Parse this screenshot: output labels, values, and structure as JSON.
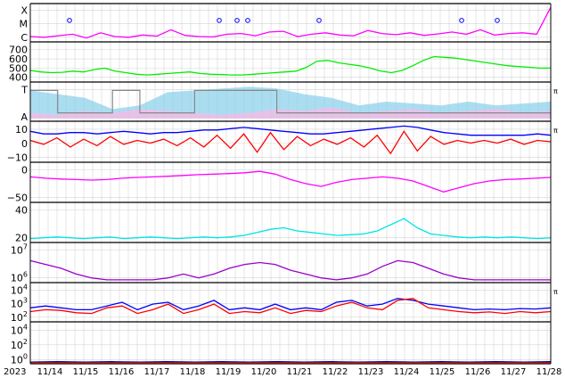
{
  "chart_data": {
    "type": "line",
    "x_axis": {
      "start_label": "2023",
      "tick_labels": [
        "11/14",
        "11/15",
        "11/16",
        "11/17",
        "11/18",
        "11/19",
        "11/20",
        "11/21",
        "11/22",
        "11/23",
        "11/24",
        "11/25",
        "11/26",
        "11/27",
        "11/28"
      ],
      "grid": true
    },
    "colors": {
      "magenta": "#ff00ff",
      "green": "#00ee00",
      "skyblue": "#87ceeb",
      "pink": "#ffb6e6",
      "gray": "#888888",
      "blue": "#0000ff",
      "red": "#ff0000",
      "purple": "#9900cc",
      "cyan": "#00e5e5",
      "darkblue": "#0000aa",
      "darkred": "#cc0000"
    },
    "panels": [
      {
        "id": "flare-class",
        "y_ticks": [
          "X",
          "M",
          "C"
        ],
        "right_label": "",
        "series": [
          {
            "color": "magenta",
            "kind": "line",
            "values": [
              0.12,
              0.1,
              0.14,
              0.18,
              0.08,
              0.22,
              0.12,
              0.1,
              0.16,
              0.13,
              0.3,
              0.15,
              0.12,
              0.11,
              0.18,
              0.2,
              0.14,
              0.24,
              0.26,
              0.12,
              0.18,
              0.22,
              0.16,
              0.14,
              0.28,
              0.2,
              0.17,
              0.22,
              0.15,
              0.19,
              0.24,
              0.18,
              0.3,
              0.16,
              0.2,
              0.22,
              0.18,
              0.9
            ]
          },
          {
            "color": "blue",
            "kind": "markers",
            "x_days": [
              1.1,
              5.3,
              5.8,
              6.1,
              8.1,
              12.1,
              13.1,
              18.9
            ],
            "values": [
              0.55,
              0.55,
              0.55,
              0.55,
              0.55,
              0.55,
              0.55,
              0.92
            ]
          }
        ]
      },
      {
        "id": "solar-wind-speed",
        "y_ticks": [
          "700",
          "600",
          "500",
          "400"
        ],
        "ylim": [
          300,
          800
        ],
        "right_label": "",
        "series": [
          {
            "color": "green",
            "kind": "line",
            "values": [
              440,
              420,
              410,
              415,
              430,
              420,
              450,
              470,
              430,
              410,
              390,
              380,
              390,
              400,
              410,
              420,
              400,
              390,
              385,
              380,
              380,
              390,
              400,
              410,
              420,
              430,
              480,
              560,
              570,
              540,
              520,
              500,
              470,
              430,
              410,
              440,
              500,
              570,
              620,
              610,
              600,
              580,
              560,
              540,
              520,
              500,
              490,
              480,
              470,
              470
            ]
          }
        ]
      },
      {
        "id": "imf-polarity",
        "y_ticks": [
          "T",
          "A"
        ],
        "right_label": "π",
        "series": [
          {
            "color": "skyblue",
            "kind": "band",
            "values": [
              0.8,
              0.7,
              0.6,
              0.3,
              0.4,
              0.75,
              0.8,
              0.85,
              0.9,
              0.85,
              0.7,
              0.6,
              0.4,
              0.5,
              0.45,
              0.4,
              0.5,
              0.4,
              0.45,
              0.5
            ]
          },
          {
            "color": "pink",
            "kind": "band",
            "values": [
              0.2,
              0.15,
              0.25,
              0.2,
              0.3,
              0.25,
              0.2,
              0.15,
              0.2,
              0.3,
              0.25,
              0.35,
              0.2,
              0.25,
              0.3,
              0.2,
              0.25,
              0.3,
              0.2,
              0.25
            ]
          },
          {
            "color": "gray",
            "kind": "step",
            "values": [
              0.8,
              0.2,
              0.2,
              0.8,
              0.2,
              0.2,
              0.8,
              0.8,
              0.8,
              0.2,
              0.2,
              0.2,
              0.2,
              0.2,
              0.2,
              0.2,
              0.2,
              0.2,
              0.2,
              0.2
            ]
          }
        ]
      },
      {
        "id": "imf-bt-bz",
        "y_ticks": [
          "10",
          "0",
          "−10"
        ],
        "ylim": [
          -15,
          15
        ],
        "right_label": "π",
        "series": [
          {
            "color": "blue",
            "kind": "line",
            "values": [
              8,
              6,
              6,
              7,
              7,
              6,
              7,
              8,
              7,
              6,
              7,
              7,
              8,
              9,
              9,
              10,
              11,
              10,
              9,
              8,
              7,
              6,
              6,
              7,
              8,
              9,
              10,
              11,
              12,
              11,
              9,
              7,
              6,
              5,
              5,
              5,
              5,
              5,
              6,
              5
            ]
          },
          {
            "color": "red",
            "kind": "line",
            "values": [
              1,
              -2,
              3,
              -4,
              2,
              -3,
              4,
              -2,
              1,
              -1,
              2,
              -3,
              3,
              -4,
              5,
              -5,
              6,
              -8,
              7,
              -6,
              4,
              -3,
              2,
              -2,
              3,
              -4,
              5,
              -9,
              8,
              -7,
              4,
              -2,
              1,
              -1,
              1,
              -1,
              2,
              -2,
              1,
              0
            ]
          }
        ]
      },
      {
        "id": "dst-index",
        "y_ticks": [
          "0",
          "−50"
        ],
        "ylim": [
          -110,
          30
        ],
        "right_label": "",
        "series": [
          {
            "color": "magenta",
            "kind": "line",
            "values": [
              -20,
              -25,
              -28,
              -30,
              -32,
              -30,
              -25,
              -22,
              -20,
              -18,
              -15,
              -12,
              -10,
              -8,
              -5,
              0,
              -10,
              -30,
              -45,
              -55,
              -40,
              -30,
              -25,
              -20,
              -25,
              -35,
              -55,
              -75,
              -60,
              -45,
              -35,
              -30,
              -28,
              -25,
              -22
            ]
          }
        ]
      },
      {
        "id": "kp-ae",
        "y_ticks": [
          "40",
          "20"
        ],
        "ylim": [
          0,
          50
        ],
        "right_label": "",
        "series": [
          {
            "color": "cyan",
            "kind": "line",
            "values": [
              4,
              5,
              6,
              5,
              4,
              5,
              6,
              4,
              5,
              6,
              5,
              4,
              5,
              6,
              5,
              6,
              8,
              12,
              16,
              18,
              14,
              12,
              10,
              8,
              9,
              10,
              14,
              22,
              30,
              18,
              10,
              8,
              6,
              5,
              6,
              5,
              6,
              5,
              4,
              5
            ]
          }
        ]
      },
      {
        "id": "electron-flux",
        "y_ticks": [
          "10^7",
          "10^6"
        ],
        "right_label": "",
        "series": [
          {
            "color": "purple",
            "kind": "line",
            "values": [
              0.55,
              0.45,
              0.35,
              0.2,
              0.1,
              0.05,
              0.05,
              0.05,
              0.05,
              0.1,
              0.2,
              0.1,
              0.2,
              0.35,
              0.45,
              0.5,
              0.45,
              0.3,
              0.2,
              0.1,
              0.05,
              0.1,
              0.2,
              0.4,
              0.55,
              0.5,
              0.35,
              0.2,
              0.1,
              0.05,
              0.05,
              0.05,
              0.05,
              0.05,
              0.05
            ]
          }
        ]
      },
      {
        "id": "xray-flux",
        "y_ticks": [
          "10^4",
          "10^3",
          "10^2"
        ],
        "right_label": "π",
        "series": [
          {
            "color": "blue",
            "kind": "line",
            "values": [
              0.35,
              0.4,
              0.35,
              0.3,
              0.3,
              0.4,
              0.5,
              0.3,
              0.45,
              0.5,
              0.3,
              0.4,
              0.55,
              0.3,
              0.35,
              0.3,
              0.45,
              0.3,
              0.35,
              0.3,
              0.5,
              0.55,
              0.4,
              0.45,
              0.6,
              0.55,
              0.45,
              0.4,
              0.35,
              0.3,
              0.32,
              0.3,
              0.33,
              0.32,
              0.35
            ]
          },
          {
            "color": "red",
            "kind": "line",
            "values": [
              0.25,
              0.3,
              0.28,
              0.22,
              0.2,
              0.35,
              0.4,
              0.2,
              0.3,
              0.45,
              0.2,
              0.3,
              0.45,
              0.2,
              0.25,
              0.22,
              0.35,
              0.2,
              0.28,
              0.25,
              0.4,
              0.5,
              0.35,
              0.3,
              0.55,
              0.6,
              0.35,
              0.3,
              0.25,
              0.22,
              0.24,
              0.2,
              0.25,
              0.22,
              0.25
            ]
          }
        ]
      },
      {
        "id": "proton-flux",
        "y_ticks": [
          "10^4",
          "10^2",
          "10^0"
        ],
        "right_label": "",
        "series": [
          {
            "color": "darkblue",
            "kind": "line",
            "values": [
              0.04,
              0.05,
              0.04,
              0.05,
              0.04,
              0.05,
              0.04,
              0.05,
              0.04,
              0.05,
              0.04,
              0.05,
              0.04,
              0.05,
              0.04,
              0.05,
              0.04,
              0.05,
              0.04,
              0.05
            ]
          },
          {
            "color": "darkred",
            "kind": "line",
            "values": [
              0.03,
              0.03,
              0.03,
              0.03,
              0.03,
              0.03,
              0.03,
              0.03,
              0.03,
              0.03,
              0.03,
              0.03,
              0.03,
              0.03,
              0.03,
              0.03,
              0.03,
              0.03,
              0.03,
              0.03
            ]
          }
        ]
      }
    ]
  }
}
